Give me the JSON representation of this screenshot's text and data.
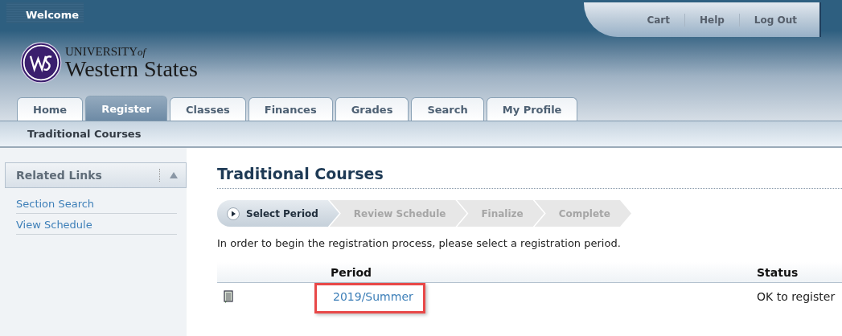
{
  "header": {
    "welcome": "Welcome",
    "logo": {
      "line_1": "UNIVERSITY",
      "line_1_suffix": "of",
      "line_2": "Western States"
    },
    "top_links": [
      "Cart",
      "Help",
      "Log Out"
    ]
  },
  "tabs": [
    {
      "label": "Home",
      "selected": false
    },
    {
      "label": "Register",
      "selected": true
    },
    {
      "label": "Classes",
      "selected": false
    },
    {
      "label": "Finances",
      "selected": false
    },
    {
      "label": "Grades",
      "selected": false
    },
    {
      "label": "Search",
      "selected": false
    },
    {
      "label": "My Profile",
      "selected": false
    }
  ],
  "subnav": [
    "Traditional Courses"
  ],
  "sidebar": {
    "title": "Related Links",
    "expanded": true,
    "links": [
      "Section Search",
      "View Schedule"
    ]
  },
  "main": {
    "title": "Traditional Courses",
    "steps": [
      {
        "label": "Select Period",
        "selected": true
      },
      {
        "label": "Review Schedule",
        "selected": false
      },
      {
        "label": "Finalize",
        "selected": false
      },
      {
        "label": "Complete",
        "selected": false
      }
    ],
    "instruction": "In order to begin the registration process, please select a registration period.",
    "table": {
      "columns": [
        "Period",
        "Status"
      ],
      "rows": [
        {
          "period": "2019/Summer",
          "status": "OK to register",
          "highlighted": true
        }
      ]
    }
  }
}
